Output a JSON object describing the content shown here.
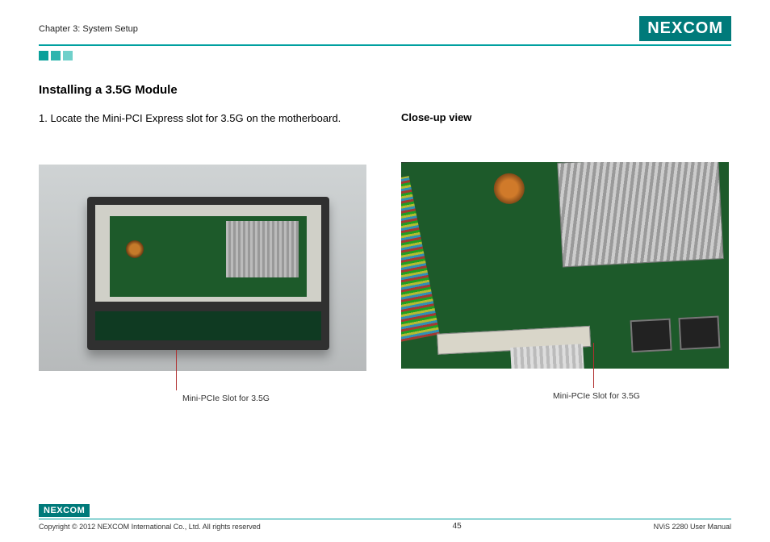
{
  "header": {
    "chapter": "Chapter 3: System Setup",
    "logo_text": "NEXCOM"
  },
  "section": {
    "title": "Installing a 3.5G Module",
    "step1": "1. Locate the Mini-PCI Express slot for 3.5G on the motherboard.",
    "closeup_label": "Close-up view"
  },
  "figures": {
    "left_caption": "Mini-PCIe Slot for 3.5G",
    "right_caption": "Mini-PCIe Slot for 3.5G"
  },
  "footer": {
    "logo_text": "NEXCOM",
    "copyright": "Copyright © 2012 NEXCOM International Co., Ltd. All rights reserved",
    "page_number": "45",
    "doc_title": "NViS 2280 User Manual"
  }
}
